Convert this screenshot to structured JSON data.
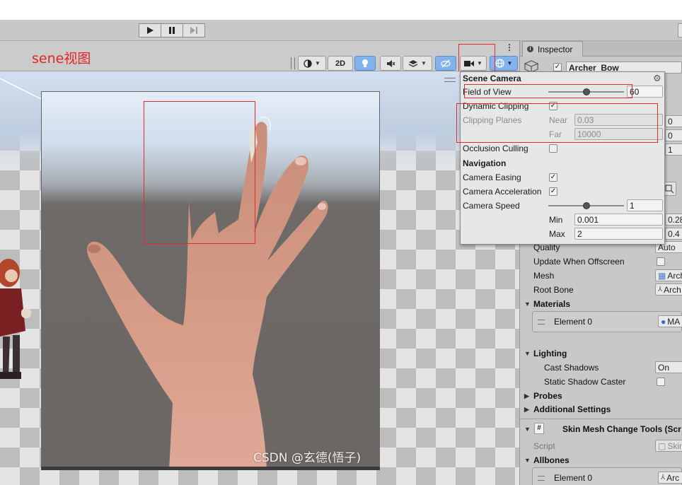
{
  "toolbar": {
    "play": "play",
    "pause": "pause",
    "step": "step"
  },
  "scene_view": {
    "annotation": "sene视图",
    "btn_2d": "2D",
    "watermark": "CSDN @玄德(悟子)"
  },
  "inspector": {
    "tab_label": "Inspector",
    "object_name": "Archer_Bow",
    "right_values": [
      "0",
      "0",
      "1",
      "0.28",
      "0.4"
    ],
    "quality_label": "Quality",
    "quality_value": "Auto",
    "update_offscreen_label": "Update When Offscreen",
    "mesh_label": "Mesh",
    "mesh_value": "Arch",
    "root_bone_label": "Root Bone",
    "root_bone_value": "Arch",
    "materials_label": "Materials",
    "materials_element": "Element 0",
    "materials_element_value": "MA",
    "lighting_label": "Lighting",
    "cast_shadows_label": "Cast Shadows",
    "cast_shadows_value": "On",
    "static_caster_label": "Static Shadow Caster",
    "probes_label": "Probes",
    "additional_label": "Additional Settings",
    "script_component_title": "Skin Mesh Change Tools (Scr",
    "script_label": "Script",
    "script_value": "Skin",
    "allbones_label": "Allbones",
    "allbones_element": "Element 0",
    "allbones_element_value": "Arc"
  },
  "scene_camera": {
    "title": "Scene Camera",
    "fov_label": "Field of View",
    "fov_value": "60",
    "fov_level": 0.5,
    "dynamic_clipping_label": "Dynamic Clipping",
    "dynamic_clipping_checked": true,
    "clipping_planes_label": "Clipping Planes",
    "near_label": "Near",
    "near_value": "0.03",
    "far_label": "Far",
    "far_value": "10000",
    "occlusion_label": "Occlusion Culling",
    "occlusion_checked": false,
    "navigation_label": "Navigation",
    "easing_label": "Camera Easing",
    "easing_checked": true,
    "accel_label": "Camera Acceleration",
    "accel_checked": true,
    "speed_label": "Camera Speed",
    "speed_value": "1",
    "speed_level": 0.5,
    "min_label": "Min",
    "min_value": "0.001",
    "max_label": "Max",
    "max_value": "2",
    "check_glyph": "✓"
  },
  "colors": {
    "annotation_red": "#e42a2a",
    "active_blue": "#83b3ea"
  }
}
